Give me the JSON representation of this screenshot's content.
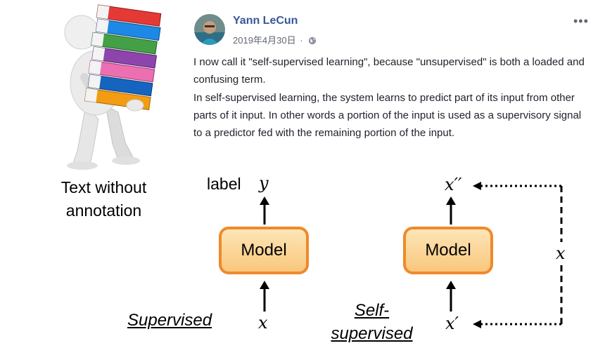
{
  "left_panel": {
    "caption_line1": "Text without",
    "caption_line2": "annotation"
  },
  "post": {
    "author": "Yann LeCun",
    "date": "2019年4月30日",
    "separator": "·",
    "paragraphs": [
      "I now call it \"self-supervised learning\", because \"unsupervised\" is both a loaded and confusing term.",
      "In self-supervised learning, the system learns to predict part of its input from other parts of it input. In other words a portion of the input is used as a supervisory signal to a predictor fed with the remaining portion of the input."
    ],
    "more_glyph": "•••",
    "icons": [
      "avatar",
      "globe-icon",
      "more-options-icon"
    ]
  },
  "diagram": {
    "supervised": {
      "model_label": "Model",
      "output_word": "label",
      "output_var": "y",
      "input_var": "x",
      "caption": "Supervised"
    },
    "self_supervised": {
      "model_label": "Model",
      "output_var": "x′′",
      "input_var": "x′",
      "side_var": "x",
      "caption_line1": "Self-",
      "caption_line2": "supervised"
    },
    "colors": {
      "model_border": "#ee8a2b",
      "model_fill_top": "#fde5b6",
      "model_fill_bottom": "#f9c77d",
      "author_link": "#385898"
    }
  }
}
